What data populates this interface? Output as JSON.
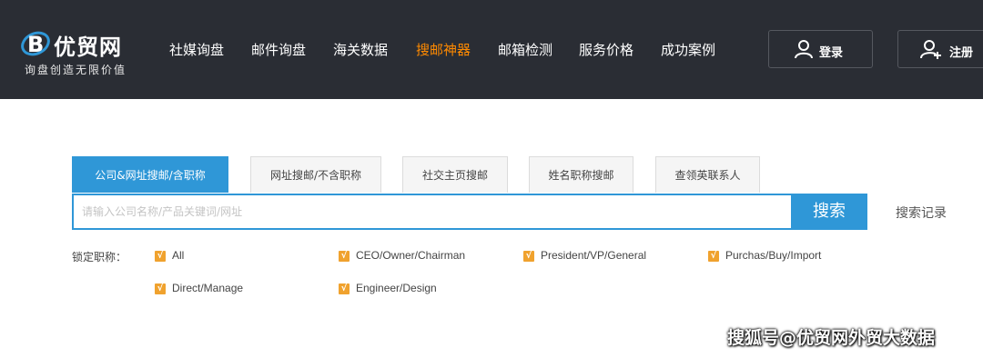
{
  "header": {
    "logo_title": "优贸网",
    "logo_subtitle": "询盘创造无限价值",
    "nav": [
      {
        "label": "社媒询盘",
        "active": false
      },
      {
        "label": "邮件询盘",
        "active": false
      },
      {
        "label": "海关数据",
        "active": false
      },
      {
        "label": "搜邮神器",
        "active": true
      },
      {
        "label": "邮箱检测",
        "active": false
      },
      {
        "label": "服务价格",
        "active": false
      },
      {
        "label": "成功案例",
        "active": false
      }
    ],
    "login_label": "登录",
    "register_label": "注册",
    "colors": {
      "background": "#2a2d34",
      "active_nav": "#ff8a00"
    }
  },
  "search": {
    "tabs": [
      {
        "label": "公司&网址搜邮/含职称",
        "active": true
      },
      {
        "label": "网址搜邮/不含职称",
        "active": false
      },
      {
        "label": "社交主页搜邮",
        "active": false
      },
      {
        "label": "姓名职称搜邮",
        "active": false
      },
      {
        "label": "查领英联系人",
        "active": false
      }
    ],
    "input_value": "",
    "placeholder": "请输入公司名称/产品关键词/网址",
    "button_label": "搜索",
    "history_label": "搜索记录",
    "accent_color": "#2f97d7"
  },
  "filters": {
    "label": "锁定职称：",
    "check_mark": "√",
    "checkbox_color": "#f0a22e",
    "options": [
      {
        "label": "All",
        "checked": true
      },
      {
        "label": "CEO/Owner/Chairman",
        "checked": true
      },
      {
        "label": "President/VP/General",
        "checked": true
      },
      {
        "label": "Purchas/Buy/Import",
        "checked": true
      },
      {
        "label": "Direct/Manage",
        "checked": true
      },
      {
        "label": "Engineer/Design",
        "checked": true
      }
    ]
  },
  "watermark": "搜狐号@优贸网外贸大数据"
}
